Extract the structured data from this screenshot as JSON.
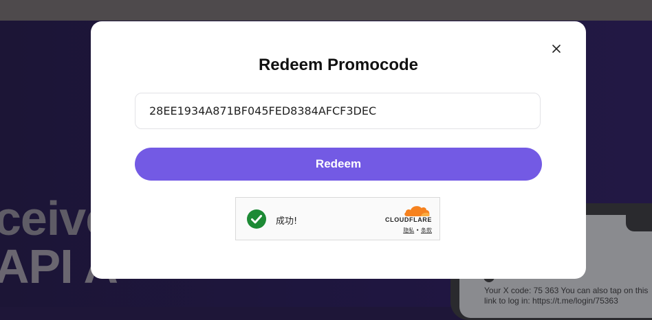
{
  "background": {
    "hero_line1": "ceive",
    "hero_line2": "API A",
    "phone_message": "Your X code: 75 363 You can also tap on this link to log in: https://t.me/login/75363"
  },
  "modal": {
    "title": "Redeem Promocode",
    "close_icon": "close-icon",
    "promo_input": {
      "value": "28EE1934A871BF045FED8384AFCF3DEC"
    },
    "redeem_label": "Redeem",
    "accent_color": "#735ae4"
  },
  "cloudflare": {
    "status_text": "成功!",
    "brand": "CLOUDFLARE",
    "privacy_link": "隐私",
    "separator": "•",
    "terms_link": "条款",
    "check_color": "#1d8a35",
    "brand_color": "#f6821f"
  }
}
